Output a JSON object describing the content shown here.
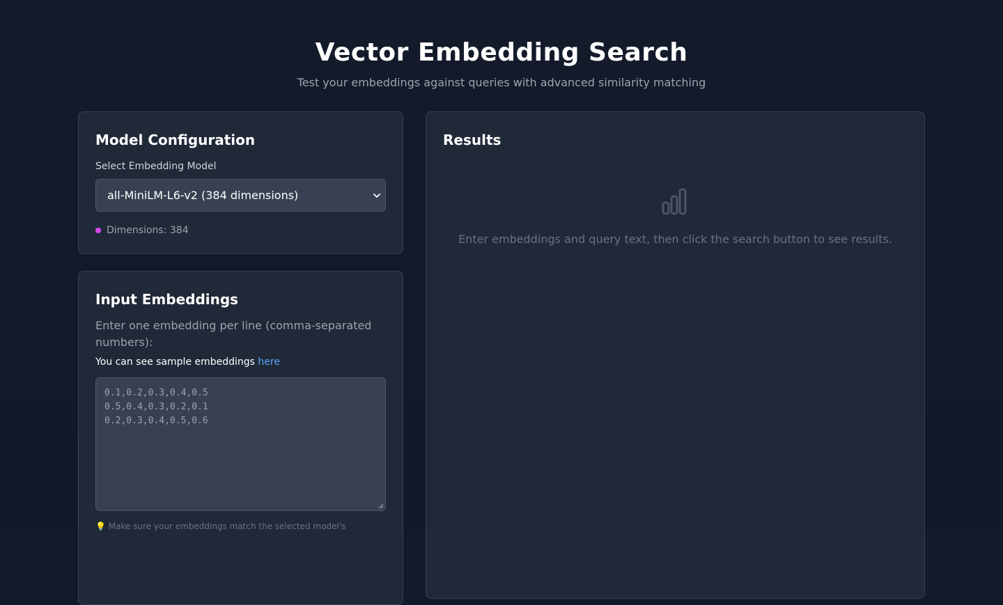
{
  "header": {
    "title": "Vector Embedding Search",
    "subtitle": "Test your embeddings against queries with advanced similarity matching"
  },
  "model_config": {
    "title": "Model Configuration",
    "select_label": "Select Embedding Model",
    "selected_model": "all-MiniLM-L6-v2 (384 dimensions)",
    "dimensions_text": "Dimensions: 384"
  },
  "input_embeddings": {
    "title": "Input Embeddings",
    "description": "Enter one embedding per line (comma-separated numbers):",
    "sample_prefix": "You can see sample embeddings ",
    "sample_link": "here",
    "textarea_lines": [
      "0.1,0.2,0.3,0.4,0.5",
      "0.5,0.4,0.3,0.2,0.1",
      "0.2,0.3,0.4,0.5,0.6"
    ],
    "hint": "💡 Make sure your embeddings match the selected model's"
  },
  "results": {
    "title": "Results",
    "empty_message": "Enter embeddings and query text, then click the search button to see results."
  },
  "icons": {
    "results_empty": "bar-chart-icon",
    "dropdown": "chevron-down-icon"
  },
  "colors": {
    "accent_dot": "#d946ef",
    "link": "#60a5fa"
  }
}
